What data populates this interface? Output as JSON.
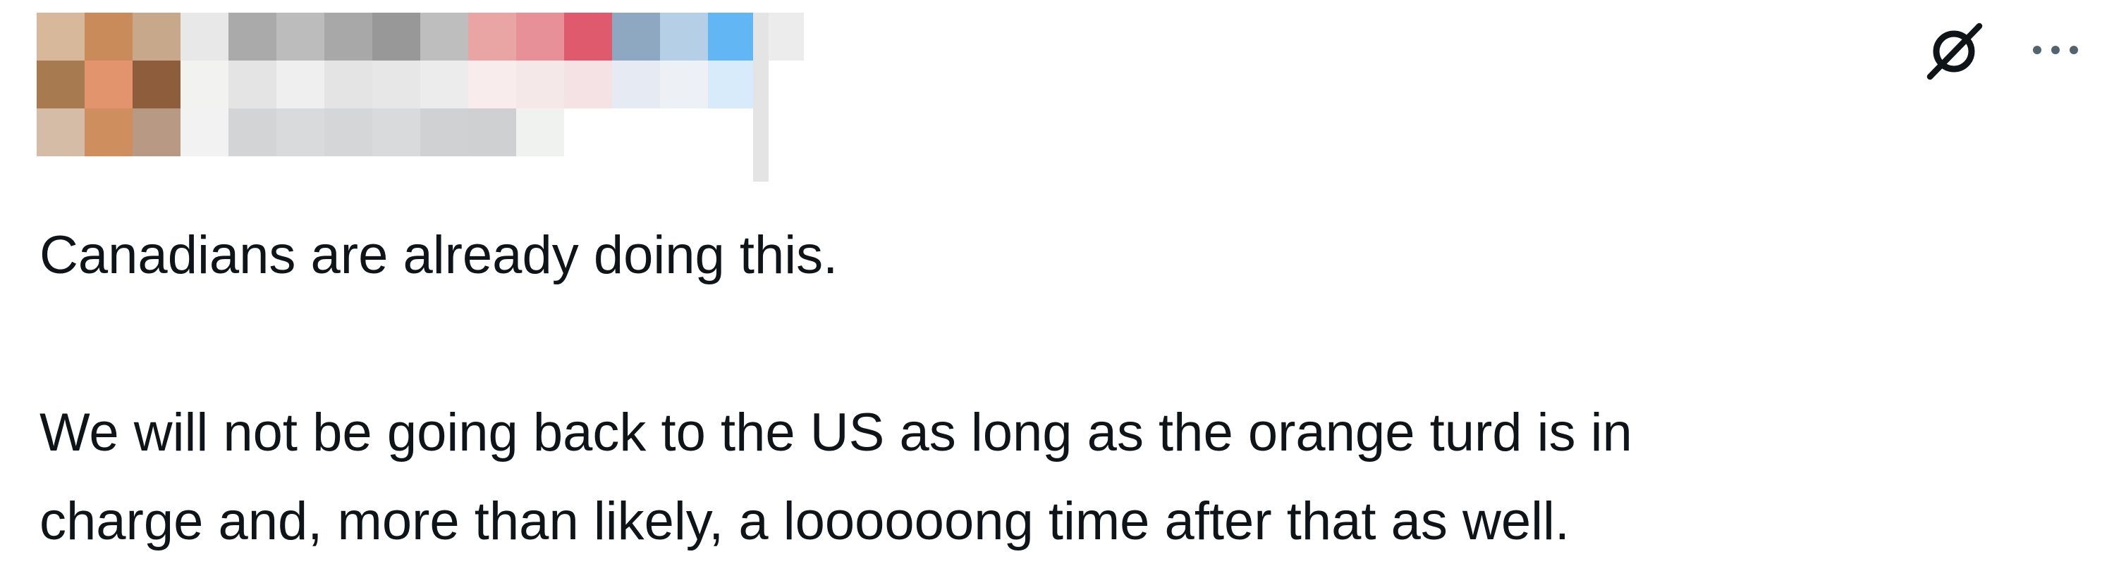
{
  "author": {
    "avatar_redacted": true,
    "name_redacted": true,
    "mosaic_colors": [
      [
        "#d8b89a",
        "#c98b5a",
        "#c8a88a",
        "#e8e8e8",
        "#aaaaaa",
        "#bcbcbc",
        "#a8a8a8",
        "#989898",
        "#bebebe",
        "#e9a4a4",
        "#e89098",
        "#e05a6e",
        "#8ea8c2",
        "#b4cfe6",
        "#62b6f4",
        "#ececec"
      ],
      [
        "#a87a50",
        "#e2956c",
        "#8e5e3c",
        "#f2f2f0",
        "#e4e4e4",
        "#efefef",
        "#e4e4e4",
        "#e7e7e7",
        "#ececec",
        "#f8ecec",
        "#f4e8e8",
        "#f4e2e4",
        "#e6eaf2",
        "#edf1f6",
        "#d8ebfa",
        "#ffffff"
      ],
      [
        "#d4bca6",
        "#ce8e5e",
        "#b89a84",
        "#f2f2f2",
        "#d2d4d6",
        "#d8dadc",
        "#d4d6d8",
        "#d8dadc",
        "#cfd1d3",
        "#ced0d2",
        "#f0f2f0",
        "#ffffff",
        "#ffffff",
        "#ffffff",
        "#ffffff",
        "#ffffff"
      ]
    ]
  },
  "actions": {
    "grok_icon": "grok-icon",
    "more_icon": "more-icon"
  },
  "post": {
    "paragraph_1": "Canadians are already doing this.",
    "paragraph_2_line_1": "We will not be going back to the US as long as the orange turd is in",
    "paragraph_2_line_2": "charge and, more than likely, a loooooong time after that as well."
  },
  "colors": {
    "text": "#0f1419",
    "icon": "#0f1419",
    "muted_icon": "#536471"
  }
}
